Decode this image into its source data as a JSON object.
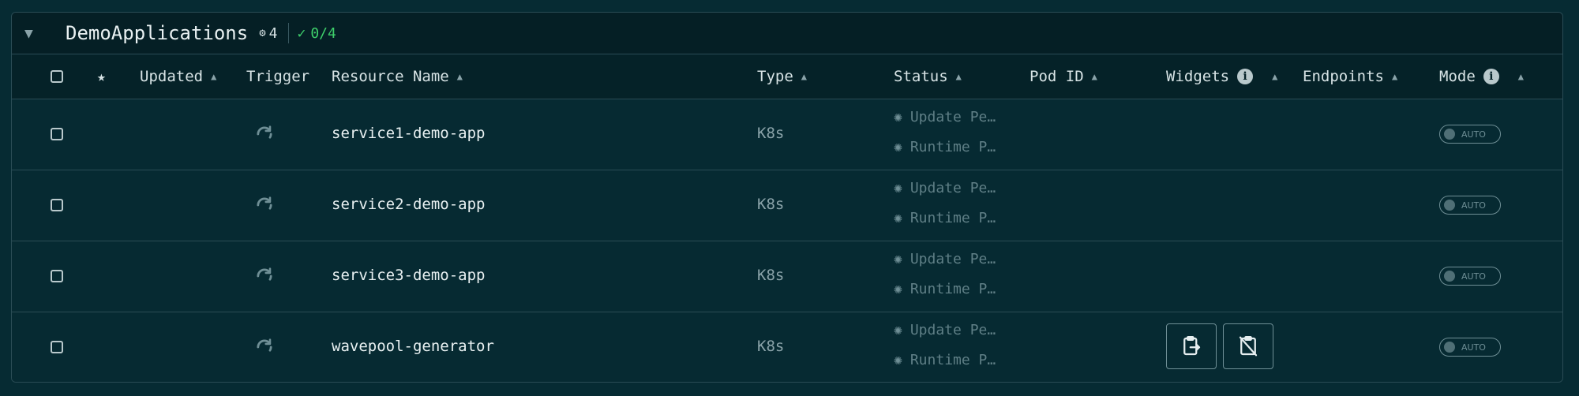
{
  "group": {
    "name": "DemoApplications",
    "resource_count": "4",
    "ok_count": "0/4"
  },
  "columns": {
    "updated": "Updated",
    "trigger": "Trigger",
    "resource_name": "Resource Name",
    "type": "Type",
    "status": "Status",
    "pod_id": "Pod ID",
    "widgets": "Widgets",
    "endpoints": "Endpoints",
    "mode": "Mode"
  },
  "rows": [
    {
      "name": "service1-demo-app",
      "type": "K8s",
      "update_status": "Update Pe…",
      "runtime_status": "Runtime P…",
      "mode": "AUTO"
    },
    {
      "name": "service2-demo-app",
      "type": "K8s",
      "update_status": "Update Pe…",
      "runtime_status": "Runtime P…",
      "mode": "AUTO"
    },
    {
      "name": "service3-demo-app",
      "type": "K8s",
      "update_status": "Update Pe…",
      "runtime_status": "Runtime P…",
      "mode": "AUTO"
    },
    {
      "name": "wavepool-generator",
      "type": "K8s",
      "update_status": "Update Pe…",
      "runtime_status": "Runtime P…",
      "mode": "AUTO"
    }
  ],
  "colors": {
    "background": "#062b33",
    "ok_green": "#3ecf6b",
    "border": "#2a4c55"
  }
}
